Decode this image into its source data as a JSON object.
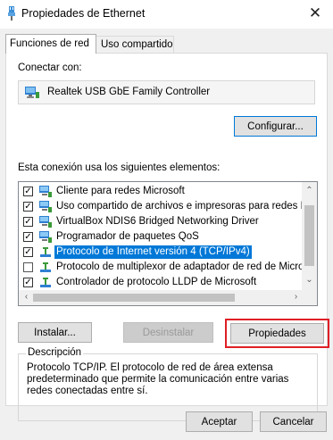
{
  "window": {
    "title": "Propiedades de Ethernet",
    "close_glyph": "✕"
  },
  "tabs": [
    {
      "label": "Funciones de red",
      "active": true
    },
    {
      "label": "Uso compartido",
      "active": false
    }
  ],
  "connect_label": "Conectar con:",
  "adapter": {
    "name": "Realtek USB GbE Family Controller",
    "icon": "network-adapter-icon"
  },
  "configure_label": "Configurar...",
  "items_label": "Esta conexión usa los siguientes elementos:",
  "items": [
    {
      "label": "Cliente para redes Microsoft",
      "checked": true,
      "icon": "network-client-icon"
    },
    {
      "label": "Uso compartido de archivos e impresoras para redes M",
      "checked": true,
      "icon": "network-service-icon"
    },
    {
      "label": "VirtualBox NDIS6 Bridged Networking Driver",
      "checked": true,
      "icon": "network-service-icon"
    },
    {
      "label": "Programador de paquetes QoS",
      "checked": true,
      "icon": "network-service-icon"
    },
    {
      "label": "Protocolo de Internet versión 4 (TCP/IPv4)",
      "checked": true,
      "selected": true,
      "icon": "protocol-icon"
    },
    {
      "label": "Protocolo de multiplexor de adaptador de red de Micros",
      "checked": false,
      "icon": "protocol-icon"
    },
    {
      "label": "Controlador de protocolo LLDP de Microsoft",
      "checked": true,
      "icon": "protocol-icon"
    }
  ],
  "buttons": {
    "install": "Instalar...",
    "uninstall": "Desinstalar",
    "properties": "Propiedades",
    "accept": "Aceptar",
    "cancel": "Cancelar"
  },
  "description": {
    "legend": "Descripción",
    "text": "Protocolo TCP/IP. El protocolo de red de área extensa predeterminado que permite la comunicación entre varias redes conectadas entre sí."
  },
  "colors": {
    "selection": "#0078d7",
    "highlight_box": "#e01f26",
    "dialog_bg": "#f0f0f0"
  }
}
